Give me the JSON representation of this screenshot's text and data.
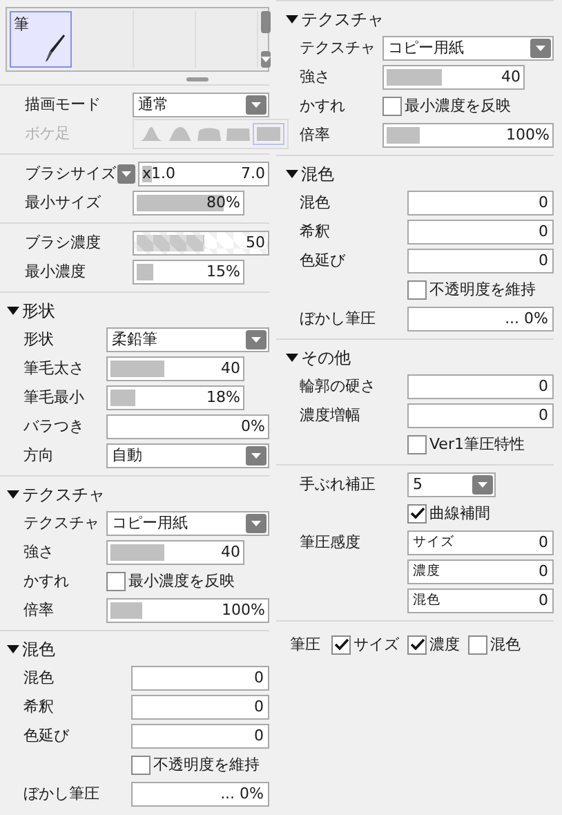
{
  "palette": {
    "items": [
      {
        "label": "筆",
        "selected": true
      }
    ]
  },
  "left": [
    {
      "kind": "group",
      "rows": [
        {
          "kind": "select",
          "label": "描画モード",
          "value": "通常"
        },
        {
          "kind": "shapes",
          "label": "ボケ足",
          "disabled": true,
          "options": [
            {
              "selected": false
            },
            {
              "selected": false
            },
            {
              "selected": false
            },
            {
              "selected": false
            },
            {
              "selected": true
            }
          ]
        }
      ]
    },
    {
      "kind": "group",
      "rows": [
        {
          "kind": "size",
          "label": "ブラシサイズ",
          "multiplier": "x1.0",
          "value": "7.0",
          "level": 0.07
        },
        {
          "kind": "slider",
          "label": "最小サイズ",
          "value": "80%",
          "level": 0.8
        }
      ]
    },
    {
      "kind": "group",
      "rows": [
        {
          "kind": "pattern_slider",
          "label": "ブラシ濃度",
          "value": "50",
          "level": 0.5
        },
        {
          "kind": "slider",
          "label": "最小濃度",
          "value": "15%",
          "level": 0.15
        }
      ]
    },
    {
      "kind": "section",
      "title": "形状",
      "expanded": true,
      "rows": [
        {
          "kind": "select",
          "label": "形状",
          "value": "柔鉛筆"
        },
        {
          "kind": "slider",
          "label": "筆毛太さ",
          "value": "40",
          "level": 0.4
        },
        {
          "kind": "slider",
          "label": "筆毛最小",
          "value": "18%",
          "level": 0.18
        },
        {
          "kind": "wide_slider",
          "label": "バラつき",
          "value": "0%"
        },
        {
          "kind": "select",
          "label": "方向",
          "value": "自動"
        }
      ]
    },
    {
      "kind": "section",
      "title": "テクスチャ",
      "expanded": true,
      "rows": [
        {
          "kind": "select",
          "label": "テクスチャ",
          "value": "コピー用紙"
        },
        {
          "kind": "slider",
          "label": "強さ",
          "value": "40",
          "level": 0.4
        },
        {
          "kind": "checkbox",
          "label": "かすれ",
          "text": "最小濃度を反映",
          "checked": false
        },
        {
          "kind": "wide_slider",
          "label": "倍率",
          "value": "100%",
          "level": 0.2
        }
      ]
    },
    {
      "kind": "section",
      "title": "混色",
      "expanded": true,
      "rows": [
        {
          "kind": "number",
          "label": "混色",
          "value": "0"
        },
        {
          "kind": "number",
          "label": "希釈",
          "value": "0"
        },
        {
          "kind": "number",
          "label": "色延び",
          "value": "0"
        },
        {
          "kind": "checkbox",
          "text": "不透明度を維持",
          "checked": false
        },
        {
          "kind": "number",
          "label": "ぼかし筆圧",
          "value": "... 0%"
        }
      ]
    }
  ],
  "right": [
    {
      "kind": "section",
      "title": "テクスチャ",
      "expanded": true,
      "rows": [
        {
          "kind": "select",
          "label": "テクスチャ",
          "value": "コピー用紙"
        },
        {
          "kind": "slider",
          "label": "強さ",
          "value": "40",
          "level": 0.4
        },
        {
          "kind": "checkbox",
          "label": "かすれ",
          "text": "最小濃度を反映",
          "checked": false
        },
        {
          "kind": "wide_slider",
          "label": "倍率",
          "value": "100%",
          "level": 0.2
        }
      ]
    },
    {
      "kind": "section",
      "title": "混色",
      "expanded": true,
      "rows": [
        {
          "kind": "number",
          "label": "混色",
          "value": "0"
        },
        {
          "kind": "number",
          "label": "希釈",
          "value": "0"
        },
        {
          "kind": "number",
          "label": "色延び",
          "value": "0"
        },
        {
          "kind": "checkbox",
          "text": "不透明度を維持",
          "checked": false
        },
        {
          "kind": "number",
          "label": "ぼかし筆圧",
          "value": "... 0%"
        }
      ]
    },
    {
      "kind": "section",
      "title": "その他",
      "expanded": true,
      "rows": [
        {
          "kind": "number",
          "label": "輪郭の硬さ",
          "value": "0"
        },
        {
          "kind": "number",
          "label": "濃度増幅",
          "value": "0"
        },
        {
          "kind": "checkbox",
          "text": "Ver1筆圧特性",
          "checked": false
        }
      ]
    },
    {
      "kind": "group",
      "rows": [
        {
          "kind": "small_select",
          "label": "手ぶれ補正",
          "value": "5"
        },
        {
          "kind": "checkbox",
          "text": "曲線補間",
          "checked": true
        },
        {
          "kind": "sub_number",
          "label": "筆圧感度",
          "text": "サイズ",
          "value": "0"
        },
        {
          "kind": "sub_number",
          "text": "濃度",
          "value": "0"
        },
        {
          "kind": "sub_number",
          "text": "混色",
          "value": "0"
        }
      ]
    },
    {
      "kind": "checks",
      "label": "筆圧",
      "items": [
        {
          "text": "サイズ",
          "checked": true
        },
        {
          "text": "濃度",
          "checked": true
        },
        {
          "text": "混色",
          "checked": false
        }
      ]
    }
  ]
}
